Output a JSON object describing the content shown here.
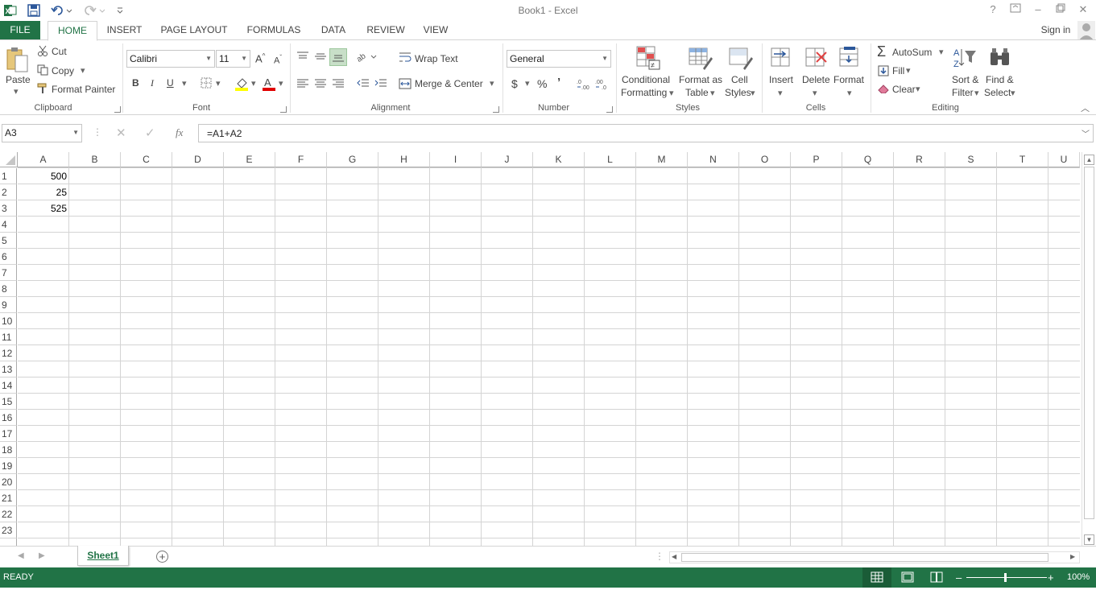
{
  "window": {
    "title": "Book1 - Excel"
  },
  "tabs": [
    {
      "label": "FILE"
    },
    {
      "label": "HOME"
    },
    {
      "label": "INSERT"
    },
    {
      "label": "PAGE LAYOUT"
    },
    {
      "label": "FORMULAS"
    },
    {
      "label": "DATA"
    },
    {
      "label": "REVIEW"
    },
    {
      "label": "VIEW"
    }
  ],
  "account": {
    "sign_in": "Sign in"
  },
  "ribbon": {
    "clipboard": {
      "label": "Clipboard",
      "paste": "Paste",
      "cut": "Cut",
      "copy": "Copy",
      "format_painter": "Format Painter"
    },
    "font": {
      "label": "Font",
      "font_name": "Calibri",
      "font_size": "11",
      "bold": "B",
      "italic": "I",
      "underline": "U"
    },
    "alignment": {
      "label": "Alignment",
      "wrap_text": "Wrap Text",
      "merge_center": "Merge & Center"
    },
    "number": {
      "label": "Number",
      "format": "General",
      "currency": "$",
      "percent": "%",
      "comma": "’"
    },
    "styles": {
      "label": "Styles",
      "conditional_line1": "Conditional",
      "conditional_line2": "Formatting",
      "format_table_line1": "Format as",
      "format_table_line2": "Table",
      "cell_styles_line1": "Cell",
      "cell_styles_line2": "Styles"
    },
    "cells": {
      "label": "Cells",
      "insert": "Insert",
      "delete": "Delete",
      "format": "Format"
    },
    "editing": {
      "label": "Editing",
      "autosum": "AutoSum",
      "fill": "Fill",
      "clear": "Clear",
      "sort_line1": "Sort &",
      "sort_line2": "Filter",
      "find_line1": "Find &",
      "find_line2": "Select"
    }
  },
  "formula_bar": {
    "name_box": "A3",
    "fx": "fx",
    "formula": "=A1+A2"
  },
  "grid": {
    "columns": [
      "A",
      "B",
      "C",
      "D",
      "E",
      "F",
      "G",
      "H",
      "I",
      "J",
      "K",
      "L",
      "M",
      "N",
      "O",
      "P",
      "Q",
      "R",
      "S",
      "T",
      "U"
    ],
    "rows": [
      "1",
      "2",
      "3",
      "4",
      "5",
      "6",
      "7",
      "8",
      "9",
      "10",
      "11",
      "12",
      "13",
      "14",
      "15",
      "16",
      "17",
      "18",
      "19",
      "20",
      "21",
      "22",
      "23"
    ],
    "cells": [
      {
        "ref": "A1",
        "value": "500"
      },
      {
        "ref": "A2",
        "value": "25"
      },
      {
        "ref": "A3",
        "value": "525"
      }
    ]
  },
  "sheets": [
    {
      "name": "Sheet1"
    }
  ],
  "status": {
    "mode": "READY",
    "zoom": "100%"
  },
  "colors": {
    "brand": "#217346",
    "grid_line": "#d4d4d4"
  }
}
